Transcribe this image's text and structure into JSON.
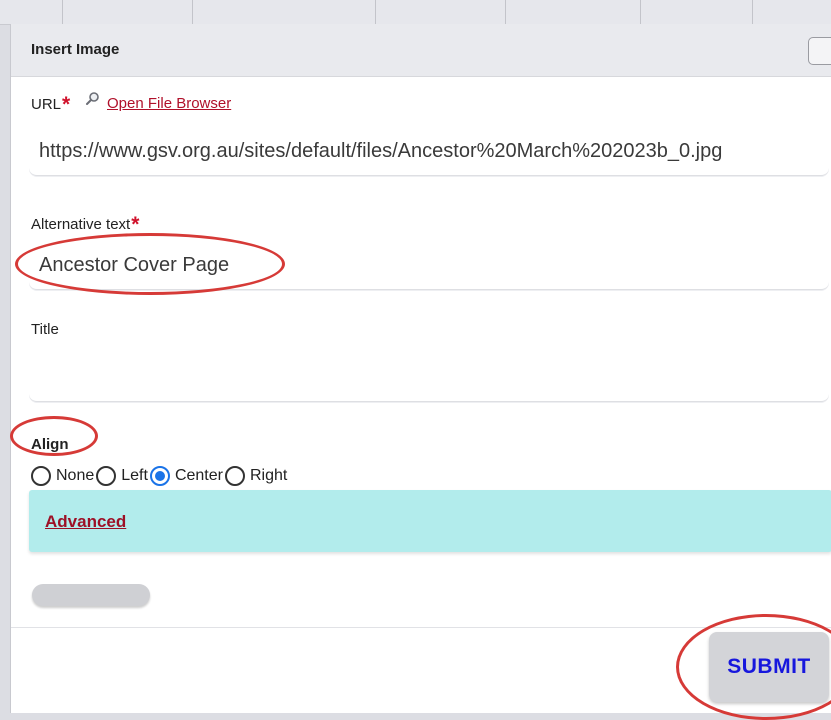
{
  "dialog": {
    "title": "Insert Image"
  },
  "url_field": {
    "label": "URL",
    "required_mark": "*",
    "browser_link": "Open File Browser",
    "value": "https://www.gsv.org.au/sites/default/files/Ancestor%20March%202023b_0.jpg"
  },
  "alt_field": {
    "label": "Alternative text",
    "required_mark": "*",
    "value": "Ancestor Cover Page"
  },
  "title_field": {
    "label": "Title",
    "value": ""
  },
  "align": {
    "label": "Align",
    "options": [
      {
        "label": "None",
        "checked": false
      },
      {
        "label": "Left",
        "checked": false
      },
      {
        "label": "Center",
        "checked": true
      },
      {
        "label": "Right",
        "checked": false
      }
    ]
  },
  "advanced": {
    "label": "Advanced"
  },
  "submit": {
    "label": "SUBMIT"
  },
  "colors": {
    "required": "#d0112b",
    "link": "#b0102a",
    "advanced_bg": "#b2ecec",
    "submit_text": "#1717dd",
    "radio_selected": "#1a73e8",
    "annotation": "#d63a37"
  }
}
